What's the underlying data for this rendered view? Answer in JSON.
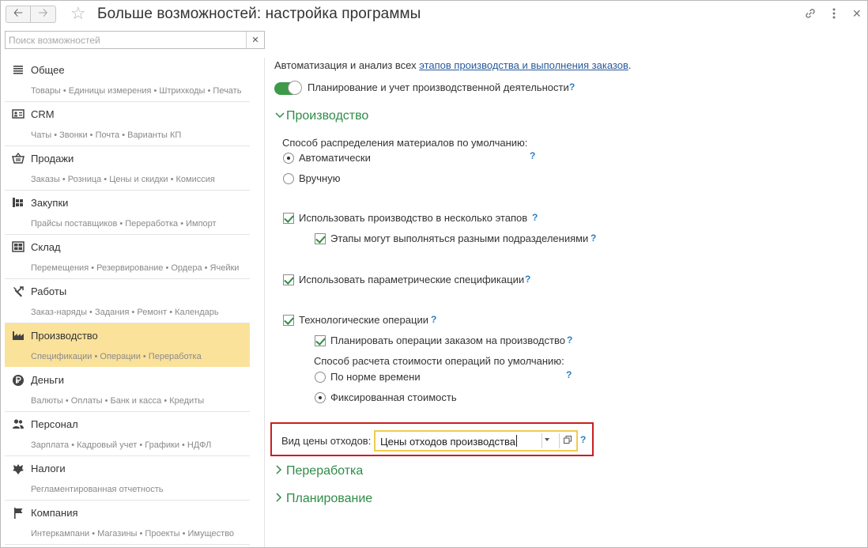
{
  "window": {
    "title": "Больше возможностей: настройка программы",
    "icons": [
      "back-arrow-icon",
      "forward-arrow-icon",
      "star-icon",
      "link-icon",
      "more-icon",
      "close-icon"
    ]
  },
  "search": {
    "placeholder": "Поиск возможностей",
    "value": ""
  },
  "sidebar": {
    "items": [
      {
        "label": "Общее",
        "icon": "list-icon",
        "sub": "Товары • Единицы измерения • Штрихкоды • Печать"
      },
      {
        "label": "CRM",
        "icon": "card-icon",
        "sub": "Чаты • Звонки • Почта • Варианты КП"
      },
      {
        "label": "Продажи",
        "icon": "basket-icon",
        "sub": "Заказы • Розница • Цены и скидки • Комиссия"
      },
      {
        "label": "Закупки",
        "icon": "purchase-icon",
        "sub": "Прайсы поставщиков • Переработка • Импорт"
      },
      {
        "label": "Склад",
        "icon": "warehouse-icon",
        "sub": "Перемещения • Резервирование • Ордера • Ячейки"
      },
      {
        "label": "Работы",
        "icon": "tools-icon",
        "sub": "Заказ-наряды • Задания • Ремонт • Календарь"
      },
      {
        "label": "Производство",
        "icon": "factory-icon",
        "sub": "Спецификации • Операции • Переработка",
        "active": true
      },
      {
        "label": "Деньги",
        "icon": "ruble-icon",
        "sub": "Валюты • Оплаты • Банк и касса • Кредиты"
      },
      {
        "label": "Персонал",
        "icon": "people-icon",
        "sub": "Зарплата • Кадровый учет • Графики • НДФЛ"
      },
      {
        "label": "Налоги",
        "icon": "emblem-icon",
        "sub": "Регламентированная отчетность"
      },
      {
        "label": "Компания",
        "icon": "flag-icon",
        "sub": "Интеркампани • Магазины • Проекты • Имущество"
      }
    ]
  },
  "main": {
    "intro_text": "Автоматизация и анализ всех ",
    "intro_link": "этапов производства и выполнения заказов",
    "intro_end": ".",
    "toggle_label": "Планирование и учет производственной деятельности",
    "help": "?",
    "group_production": "Производство",
    "distribution_label": "Способ распределения материалов по умолчанию:",
    "radio_auto": "Автоматически",
    "radio_manual": "Вручную",
    "cb_stages": "Использовать производство в несколько этапов",
    "cb_stages_divisions": "Этапы могут выполняться разными подразделениями",
    "cb_parametric": "Использовать параметрические спецификации",
    "cb_tech_ops": "Технологические операции",
    "cb_plan_ops": "Планировать операции заказом на производство",
    "cost_method_label": "Способ расчета стоимости операций по умолчанию:",
    "radio_norm": "По норме времени",
    "radio_fixed": "Фиксированная стоимость",
    "waste_price_label": "Вид цены отходов:",
    "waste_price_value": "Цены отходов производства",
    "group_processing": "Переработка",
    "group_planning": "Планирование"
  },
  "colors": {
    "accent_green": "#2f8c47",
    "active_yellow": "#fbe29b",
    "highlight_red": "#c8201e",
    "field_yellow": "#f0cc50",
    "link_blue": "#2a5a9a"
  }
}
